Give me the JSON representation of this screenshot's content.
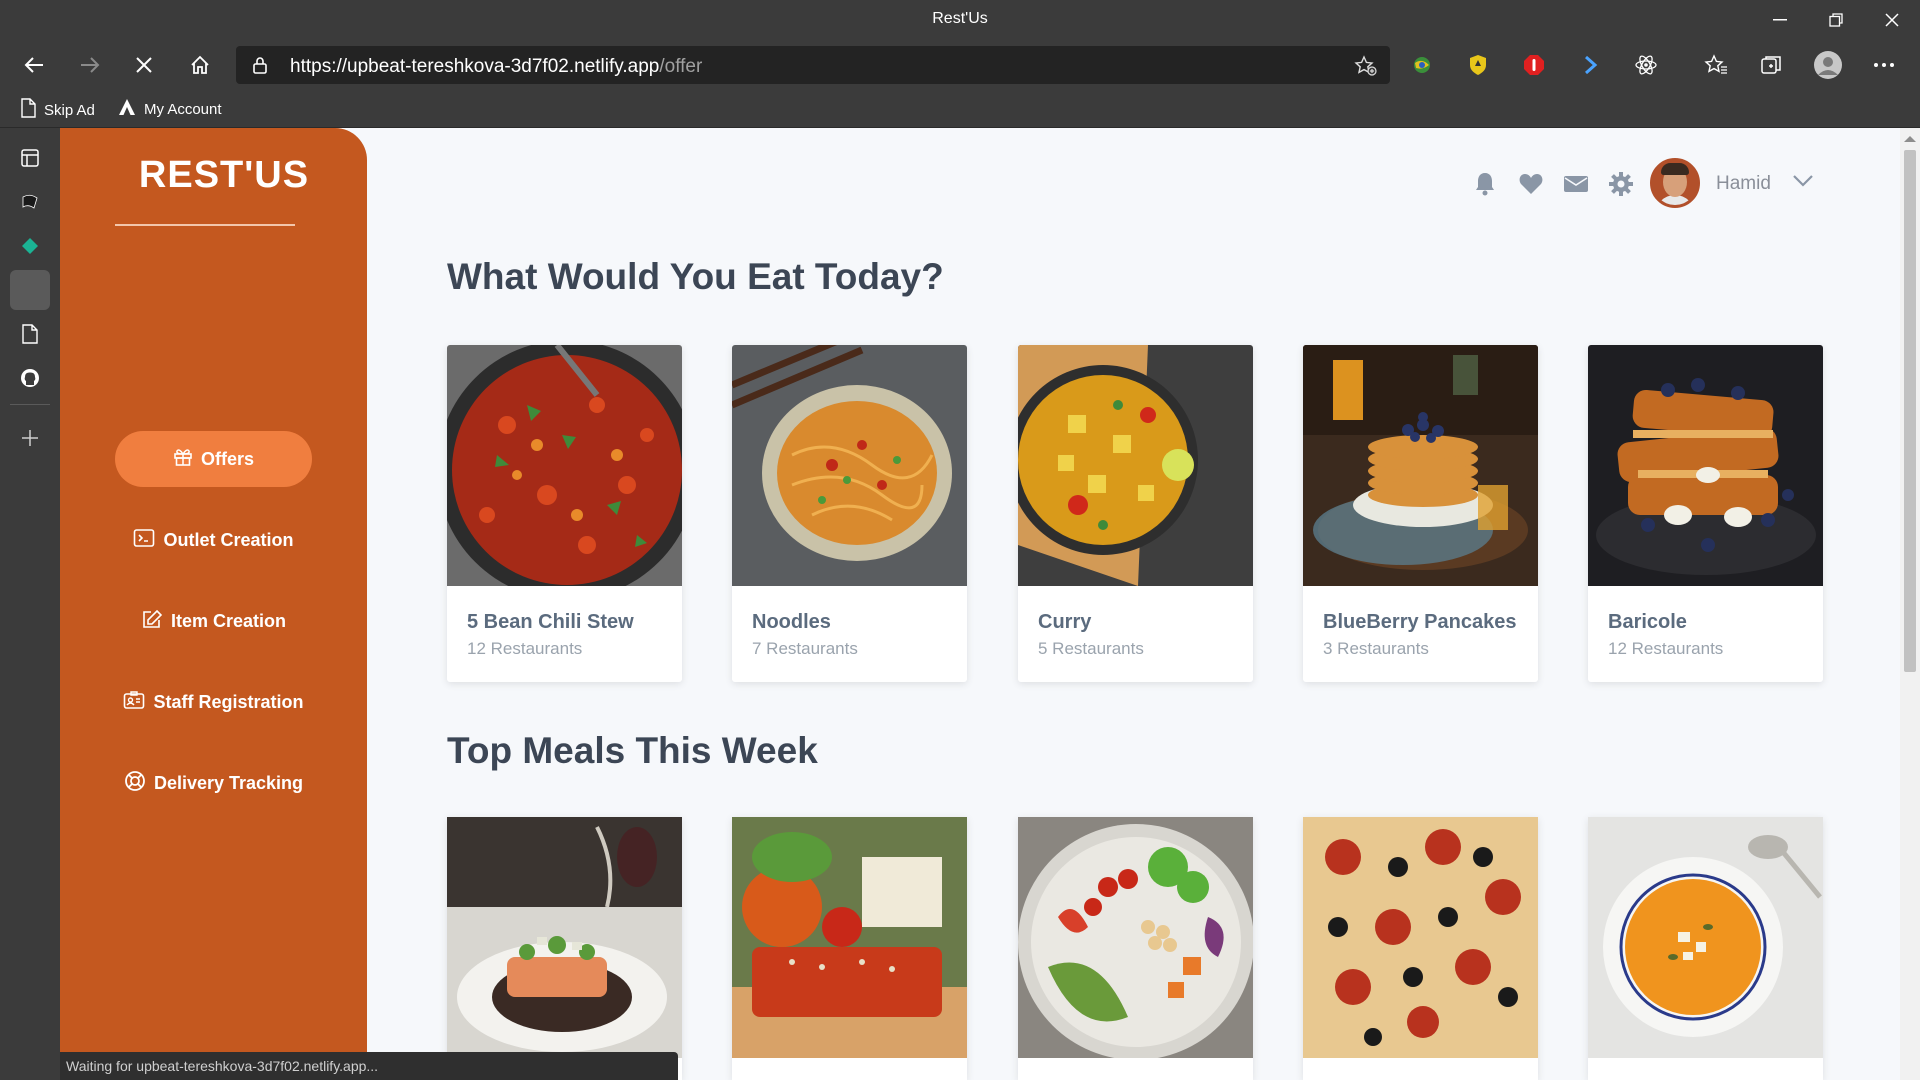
{
  "window": {
    "title": "Rest'Us"
  },
  "browser": {
    "url_main": "https://upbeat-tereshkova-3d7f02.netlify.app",
    "url_path": "/offer",
    "bookmarks": [
      {
        "label": "Skip Ad",
        "icon": "page-icon"
      },
      {
        "label": "My Account",
        "icon": "a-logo-icon"
      }
    ],
    "status_text": "Waiting for upbeat-tereshkova-3d7f02.netlify.app..."
  },
  "sidebar": {
    "brand": "REST'US",
    "menu": [
      {
        "label": "Offers",
        "icon": "gift-icon",
        "active": true
      },
      {
        "label": "Outlet Creation",
        "icon": "terminal-icon",
        "active": false
      },
      {
        "label": "Item Creation",
        "icon": "edit-icon",
        "active": false
      },
      {
        "label": "Staff Registration",
        "icon": "id-card-icon",
        "active": false
      },
      {
        "label": "Delivery Tracking",
        "icon": "lifebuoy-icon",
        "active": false
      }
    ]
  },
  "header": {
    "icons": [
      "bell-icon",
      "heart-icon",
      "envelope-icon",
      "gear-icon"
    ],
    "username": "Hamid"
  },
  "sections": {
    "today_title": "What Would You Eat Today?",
    "today_items": [
      {
        "name": "5 Bean Chili Stew",
        "count": "12 Restaurants"
      },
      {
        "name": "Noodles",
        "count": "7 Restaurants"
      },
      {
        "name": "Curry",
        "count": "5 Restaurants"
      },
      {
        "name": "BlueBerry Pancakes",
        "count": "3 Restaurants"
      },
      {
        "name": "Baricole",
        "count": "12 Restaurants"
      }
    ],
    "top_title": "Top Meals This Week"
  },
  "colors": {
    "sidebar": "#c4581f",
    "active_pill": "#f07e3f",
    "page_bg": "#f6f8fb",
    "title_text": "#3c4655"
  }
}
